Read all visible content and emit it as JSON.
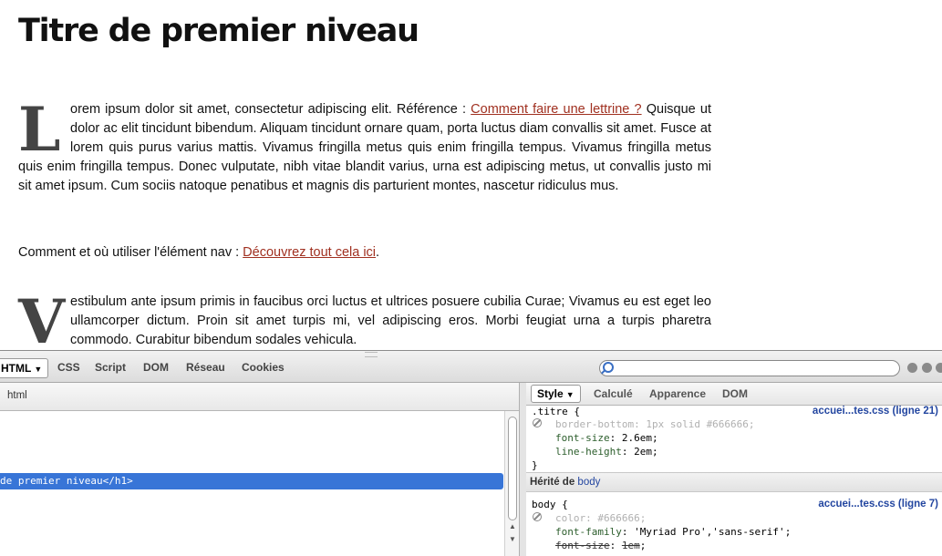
{
  "page": {
    "title": "Titre de premier niveau",
    "p1": {
      "dropcap": "L",
      "text_before": "orem ipsum dolor sit amet, consectetur adipiscing elit. Référence : ",
      "link": "Comment faire une lettrine ?",
      "text_after": " Quisque ut dolor ac elit tincidunt bibendum. Aliquam tincidunt ornare quam, porta luctus diam convallis sit amet. Fusce at lorem quis purus varius mattis. Vivamus fringilla metus quis enim fringilla tempus. Vivamus fringilla metus quis enim fringilla tempus. Donec vulputate, nibh vitae blandit varius, urna est adipiscing metus, ut convallis justo mi sit amet ipsum. Cum sociis natoque penatibus et magnis dis parturient montes, nascetur ridiculus mus."
    },
    "p2": {
      "text": "Comment et où utiliser l'élément nav : ",
      "link": "Découvrez tout cela ici",
      "after": "."
    },
    "p3": {
      "dropcap": "V",
      "text": "estibulum ante ipsum primis in faucibus orci luctus et ultrices posuere cubilia Curae; Vivamus eu est eget leo ullamcorper dictum. Proin sit amet turpis mi, vel adipiscing eros. Morbi feugiat urna a turpis pharetra commodo. Curabitur bibendum sodales vehicula."
    }
  },
  "devtools": {
    "tabs": [
      "HTML",
      "CSS",
      "Script",
      "DOM",
      "Réseau",
      "Cookies"
    ],
    "breadcrumb": "html",
    "selected_node": "de premier niveau</h1>",
    "side_tabs": [
      "Style",
      "Calculé",
      "Apparence",
      "DOM"
    ],
    "rule1": {
      "selector": ".titre {",
      "source": "accuei...tes.css (ligne 21)",
      "disabled_decl": "border-bottom: 1px solid #666666;",
      "p1": "font-size",
      "v1": "2.6em",
      "p2": "line-height",
      "v2": "2em",
      "close": "}"
    },
    "inherited": {
      "label": "Hérité de",
      "link": "body"
    },
    "rule2": {
      "selector": "body {",
      "source": "accuei...tes.css (ligne 7)",
      "disabled_decl": "color: #666666;",
      "p1": "font-family",
      "v1": "'Myriad Pro','sans-serif'",
      "p2": "font-size",
      "v2": "1em"
    },
    "colors": {
      "selection": "#3875d7",
      "link": "#a03020"
    }
  }
}
